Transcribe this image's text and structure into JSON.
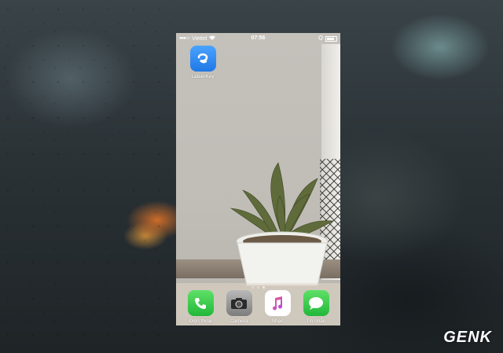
{
  "status_bar": {
    "carrier": "Viettel",
    "time": "07:56",
    "battery_level": 0.85
  },
  "home_apps": [
    {
      "label": "LabanKey",
      "icon": "labankey-icon",
      "color": "#2f8df5"
    }
  ],
  "page_indicator": {
    "count": 3,
    "active": 3
  },
  "dock_apps": [
    {
      "label": "Điện thoại",
      "icon": "phone-icon",
      "color": "#3fcd4f"
    },
    {
      "label": "Camera",
      "icon": "camera-icon",
      "color": "#8a8a8a"
    },
    {
      "label": "Nhạc",
      "icon": "music-icon",
      "color": "#ffffff"
    },
    {
      "label": "Tin nhắn",
      "icon": "messages-icon",
      "color": "#3fcd4f"
    }
  ],
  "watermark": "GENK"
}
